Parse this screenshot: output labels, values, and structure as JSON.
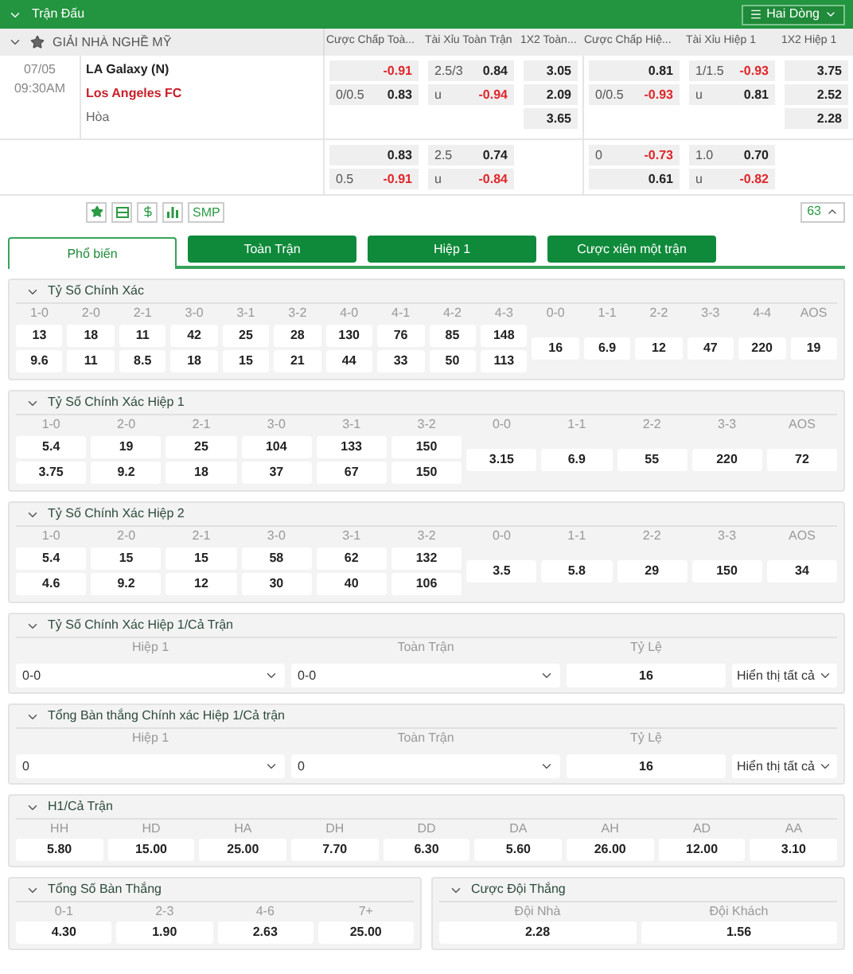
{
  "header": {
    "title": "Trận Đấu",
    "view_button": "Hai Dòng"
  },
  "league": {
    "name": "GIẢI NHÀ NGHỀ MỸ",
    "columns": [
      "Cược Chấp Toà...",
      "Tài Xỉu Toàn Trận",
      "1X2 Toàn...",
      "Cược Chấp Hiệ...",
      "Tài Xỉu Hiệp 1",
      "1X2 Hiệp 1"
    ]
  },
  "match": {
    "date": "07/05",
    "time": "09:30AM",
    "home": "LA Galaxy (N)",
    "away": "Los Angeles FC",
    "draw": "Hòa",
    "blocks": [
      {
        "columns": [
          [
            {
              "odds": "-0.91",
              "negative": true
            },
            {
              "line": "0/0.5",
              "odds": "0.83",
              "negative": false
            }
          ],
          [
            {
              "line": "2.5/3",
              "odds": "0.84",
              "negative": false
            },
            {
              "line": "u",
              "odds": "-0.94",
              "negative": true
            }
          ],
          [
            {
              "odds": "3.05",
              "negative": false
            },
            {
              "odds": "2.09",
              "negative": false
            },
            {
              "odds": "3.65",
              "negative": false
            }
          ],
          [
            {
              "odds": "0.81",
              "negative": false
            },
            {
              "line": "0/0.5",
              "odds": "-0.93",
              "negative": true
            }
          ],
          [
            {
              "line": "1/1.5",
              "odds": "-0.93",
              "negative": true
            },
            {
              "line": "u",
              "odds": "0.81",
              "negative": false
            }
          ],
          [
            {
              "odds": "3.75",
              "negative": false
            },
            {
              "odds": "2.52",
              "negative": false
            },
            {
              "odds": "2.28",
              "negative": false
            }
          ]
        ]
      },
      {
        "columns": [
          [
            {
              "odds": "0.83",
              "negative": false
            },
            {
              "line": "0.5",
              "odds": "-0.91",
              "negative": true
            }
          ],
          [
            {
              "line": "2.5",
              "odds": "0.74",
              "negative": false
            },
            {
              "line": "u",
              "odds": "-0.84",
              "negative": true
            }
          ],
          [],
          [
            {
              "line": "0",
              "odds": "-0.73",
              "negative": true
            },
            {
              "odds": "0.61",
              "negative": false
            }
          ],
          [
            {
              "line": "1.0",
              "odds": "0.70",
              "negative": false
            },
            {
              "line": "u",
              "odds": "-0.82",
              "negative": true
            }
          ],
          []
        ]
      }
    ]
  },
  "toolbar": {
    "smp": "SMP",
    "count": "63"
  },
  "tabs": [
    {
      "label": "Phổ biến",
      "selected": true
    },
    {
      "label": "Toàn Trận",
      "selected": false
    },
    {
      "label": "Hiệp 1",
      "selected": false
    },
    {
      "label": "Cược xiên một trận",
      "selected": false
    }
  ],
  "sections": [
    {
      "kind": "grid",
      "title": "Tỷ Số Chính Xác",
      "columns": [
        {
          "label": "1-0",
          "values": [
            "13",
            "9.6"
          ]
        },
        {
          "label": "2-0",
          "values": [
            "18",
            "11"
          ]
        },
        {
          "label": "2-1",
          "values": [
            "11",
            "8.5"
          ]
        },
        {
          "label": "3-0",
          "values": [
            "42",
            "18"
          ]
        },
        {
          "label": "3-1",
          "values": [
            "25",
            "15"
          ]
        },
        {
          "label": "3-2",
          "values": [
            "28",
            "21"
          ]
        },
        {
          "label": "4-0",
          "values": [
            "130",
            "44"
          ]
        },
        {
          "label": "4-1",
          "values": [
            "76",
            "33"
          ]
        },
        {
          "label": "4-2",
          "values": [
            "85",
            "50"
          ]
        },
        {
          "label": "4-3",
          "values": [
            "148",
            "113"
          ]
        },
        {
          "label": "0-0",
          "values": [
            "16"
          ]
        },
        {
          "label": "1-1",
          "values": [
            "6.9"
          ]
        },
        {
          "label": "2-2",
          "values": [
            "12"
          ]
        },
        {
          "label": "3-3",
          "values": [
            "47"
          ]
        },
        {
          "label": "4-4",
          "values": [
            "220"
          ]
        },
        {
          "label": "AOS",
          "values": [
            "19"
          ]
        }
      ]
    },
    {
      "kind": "grid",
      "title": "Tỷ Số Chính Xác Hiệp 1",
      "columns": [
        {
          "label": "1-0",
          "values": [
            "5.4",
            "3.75"
          ]
        },
        {
          "label": "2-0",
          "values": [
            "19",
            "9.2"
          ]
        },
        {
          "label": "2-1",
          "values": [
            "25",
            "18"
          ]
        },
        {
          "label": "3-0",
          "values": [
            "104",
            "37"
          ]
        },
        {
          "label": "3-1",
          "values": [
            "133",
            "67"
          ]
        },
        {
          "label": "3-2",
          "values": [
            "150",
            "150"
          ]
        },
        {
          "label": "0-0",
          "values": [
            "3.15"
          ]
        },
        {
          "label": "1-1",
          "values": [
            "6.9"
          ]
        },
        {
          "label": "2-2",
          "values": [
            "55"
          ]
        },
        {
          "label": "3-3",
          "values": [
            "220"
          ]
        },
        {
          "label": "AOS",
          "values": [
            "72"
          ]
        }
      ]
    },
    {
      "kind": "grid",
      "title": "Tỷ Số Chính Xác Hiệp 2",
      "columns": [
        {
          "label": "1-0",
          "values": [
            "5.4",
            "4.6"
          ]
        },
        {
          "label": "2-0",
          "values": [
            "15",
            "9.2"
          ]
        },
        {
          "label": "2-1",
          "values": [
            "15",
            "12"
          ]
        },
        {
          "label": "3-0",
          "values": [
            "58",
            "30"
          ]
        },
        {
          "label": "3-1",
          "values": [
            "62",
            "40"
          ]
        },
        {
          "label": "3-2",
          "values": [
            "132",
            "106"
          ]
        },
        {
          "label": "0-0",
          "values": [
            "3.5"
          ]
        },
        {
          "label": "1-1",
          "values": [
            "5.8"
          ]
        },
        {
          "label": "2-2",
          "values": [
            "29"
          ]
        },
        {
          "label": "3-3",
          "values": [
            "150"
          ]
        },
        {
          "label": "AOS",
          "values": [
            "34"
          ]
        }
      ]
    },
    {
      "kind": "selector",
      "title": "Tỷ Số Chính Xác Hiệp 1/Cả Trận",
      "headers": [
        "Hiệp 1",
        "Toàn Trận",
        "Tỷ Lệ"
      ],
      "first": "0-0",
      "second": "0-0",
      "odds": "16",
      "show_all": "Hiển thị tất cả"
    },
    {
      "kind": "selector",
      "title": "Tổng Bàn thắng Chính xác Hiệp 1/Cả trận",
      "headers": [
        "Hiệp 1",
        "Toàn Trận",
        "Tỷ Lệ"
      ],
      "first": "0",
      "second": "0",
      "odds": "16",
      "show_all": "Hiển thị tất cả"
    },
    {
      "kind": "simple",
      "title": "H1/Cả Trận",
      "columns": [
        {
          "label": "HH",
          "value": "5.80"
        },
        {
          "label": "HD",
          "value": "15.00"
        },
        {
          "label": "HA",
          "value": "25.00"
        },
        {
          "label": "DH",
          "value": "7.70"
        },
        {
          "label": "DD",
          "value": "6.30"
        },
        {
          "label": "DA",
          "value": "5.60"
        },
        {
          "label": "AH",
          "value": "26.00"
        },
        {
          "label": "AD",
          "value": "12.00"
        },
        {
          "label": "AA",
          "value": "3.10"
        }
      ]
    },
    {
      "kind": "pair",
      "sections": [
        {
          "kind": "simple",
          "title": "Tổng Số Bàn Thắng",
          "columns": [
            {
              "label": "0-1",
              "value": "4.30"
            },
            {
              "label": "2-3",
              "value": "1.90"
            },
            {
              "label": "4-6",
              "value": "2.63"
            },
            {
              "label": "7+",
              "value": "25.00"
            }
          ]
        },
        {
          "kind": "simple",
          "title": "Cược Đội Thắng",
          "columns": [
            {
              "label": "Đội Nhà",
              "value": "2.28"
            },
            {
              "label": "Đội Khách",
              "value": "1.56"
            }
          ]
        }
      ]
    }
  ]
}
